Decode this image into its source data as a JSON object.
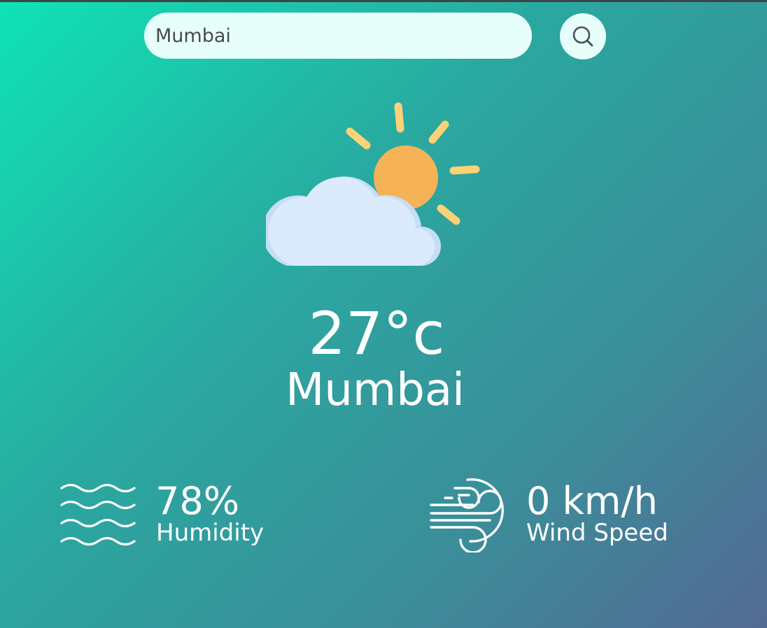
{
  "search": {
    "value": "Mumbai",
    "button_icon": "search-icon"
  },
  "weather": {
    "icon": "partly-cloudy-icon",
    "temperature": "27°c",
    "city": "Mumbai"
  },
  "details": {
    "humidity": {
      "icon": "humidity-waves-icon",
      "value": "78%",
      "label": "Humidity"
    },
    "wind": {
      "icon": "wind-icon",
      "value": "0 km/h",
      "label": "Wind Speed"
    }
  },
  "colors": {
    "gradient_start": "#0fe3b5",
    "gradient_end": "#536a94",
    "search_bg": "#e7fffb",
    "sun": "#f5b256",
    "sun_rays": "#fcd276",
    "cloud": "#dcebfb"
  }
}
